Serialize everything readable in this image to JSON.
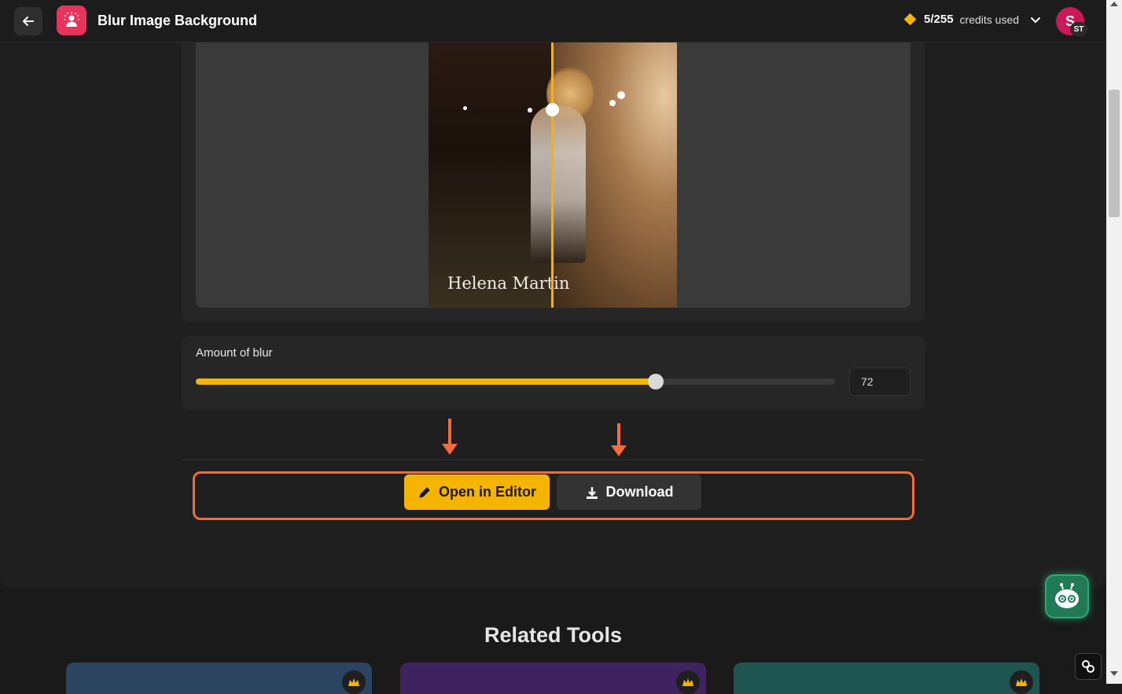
{
  "header": {
    "title": "Blur Image Background",
    "back_icon": "arrow-left-icon",
    "logo_icon": "blur-person-icon",
    "credits_used": "5/255",
    "credits_label": "credits used",
    "avatar_letter": "S",
    "avatar_badge": "ST",
    "avatar_color": "#c9195a"
  },
  "preview": {
    "photo_caption": "Helena Martin"
  },
  "blur": {
    "label": "Amount of blur",
    "value": "72",
    "level_percent": 72
  },
  "actions": {
    "editor_label": "Open in Editor",
    "download_label": "Download"
  },
  "related": {
    "title": "Related Tools",
    "cards": [
      {
        "color": "#2b4560"
      },
      {
        "color": "#3f2361"
      },
      {
        "color": "#1f5550"
      }
    ]
  },
  "colors": {
    "accent": "#f5b400",
    "highlight": "#f26b3a"
  }
}
